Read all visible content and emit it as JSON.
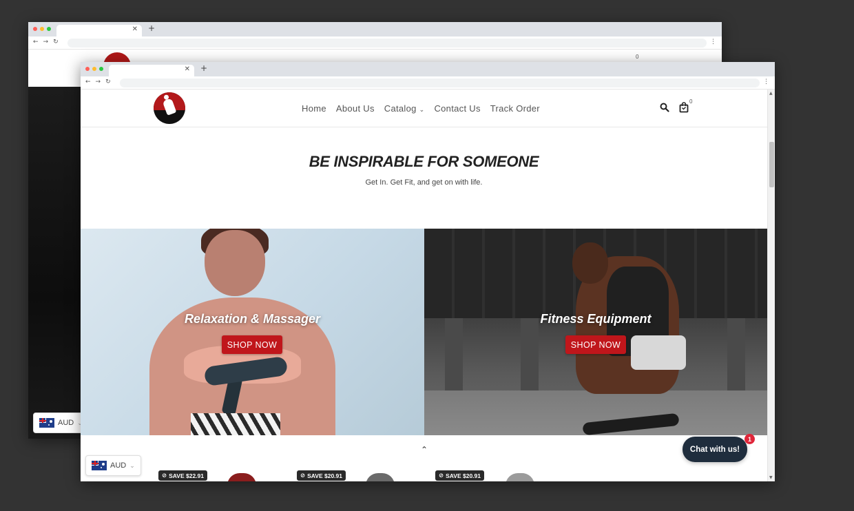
{
  "back_window": {
    "currency": {
      "code": "AUD"
    },
    "cart_count": "0"
  },
  "front_window": {
    "nav": {
      "items": [
        "Home",
        "About Us",
        "Catalog",
        "Contact Us",
        "Track Order"
      ]
    },
    "cart_count": "0",
    "hero": {
      "title": "BE INSPIRABLE FOR SOMEONE",
      "subtitle": "Get In. Get Fit, and get on with life."
    },
    "banners": [
      {
        "title": "Relaxation & Massager",
        "button": "SHOP NOW"
      },
      {
        "title": "Fitness Equipment",
        "button": "SHOP NOW"
      }
    ],
    "currency": {
      "code": "AUD"
    },
    "chat": {
      "label": "Chat with us!",
      "badge": "1"
    },
    "products": [
      {
        "save": "SAVE $22.91",
        "color": "#8a1d1d"
      },
      {
        "save": "SAVE $20.91",
        "color": "#6a6a6a"
      },
      {
        "save": "SAVE $20.91",
        "color": "#9b9b9b"
      }
    ]
  },
  "colors": {
    "accent": "#c0161b",
    "chat_bg": "#1f2d3d",
    "backdrop": "#333333"
  },
  "icons": [
    "search-icon",
    "cart-icon",
    "chevron-down-icon",
    "chevron-up-icon",
    "tag-icon",
    "close-icon",
    "plus-icon",
    "back-icon",
    "forward-icon",
    "reload-icon",
    "menu-dots-icon"
  ]
}
